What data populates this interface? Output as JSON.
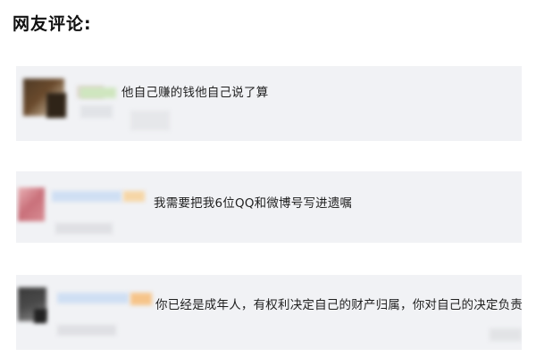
{
  "heading": "网友评论:",
  "comments": [
    {
      "text": "他自己赚的钱他自己说了算"
    },
    {
      "text": "我需要把我6位QQ和微博号写进遗嘱"
    },
    {
      "text": "你已经是成年人，有权利决定自己的财产归属，你对自己的决定负责就好。"
    }
  ]
}
